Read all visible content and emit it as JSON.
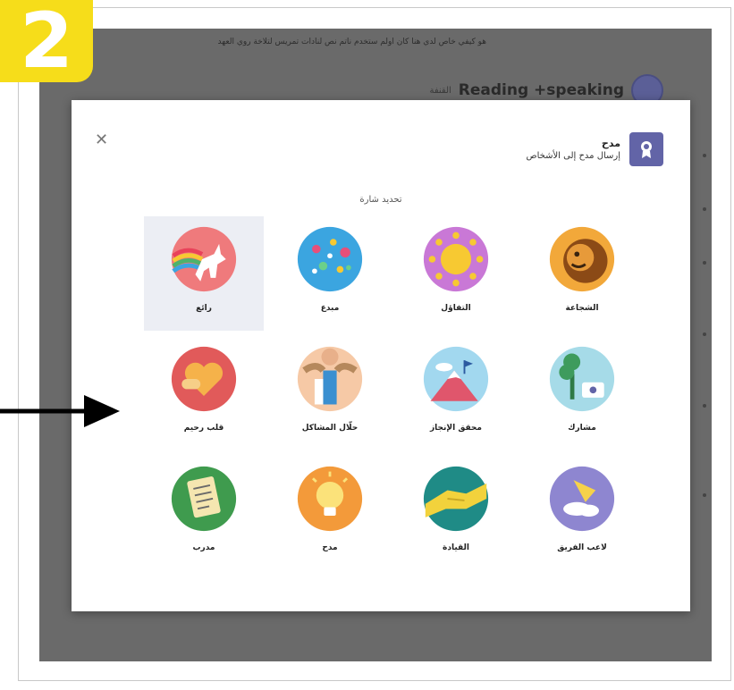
{
  "step_badge": {
    "number": "2"
  },
  "background": {
    "notice": "هو كيفي خاص لدي هنا كان اولم ستخدم ناتم نص لنادات تمريس لتلاخة روي العهد",
    "team_title": "Reading +speaking",
    "team_subtitle": "القنفة"
  },
  "modal": {
    "close_icon": "close-icon",
    "app_name": "مدح",
    "app_description": "إرسال مدح إلى الأشخاص",
    "section_label": "تحديد شارة",
    "badges": [
      {
        "label": "الشجاعة",
        "icon": "lion-icon",
        "colors": [
          "#f2a83a",
          "#8b4a16"
        ]
      },
      {
        "label": "التفاؤل",
        "icon": "sun-icon",
        "colors": [
          "#c978d6",
          "#f7c932"
        ]
      },
      {
        "label": "مبدع",
        "icon": "bubbles-icon",
        "colors": [
          "#3ba5e0",
          "#e64f7a"
        ]
      },
      {
        "label": "رائع",
        "icon": "unicorn-icon",
        "colors": [
          "#ef7a7c",
          "#ffffff"
        ],
        "selected": true
      },
      {
        "label": "مشارك",
        "icon": "tree-icon",
        "colors": [
          "#a6dbe8",
          "#3e9b5d"
        ]
      },
      {
        "label": "محقق الإنجاز",
        "icon": "mountain-icon",
        "colors": [
          "#a2d8ef",
          "#e0566c"
        ]
      },
      {
        "label": "حلّال المشاكل",
        "icon": "problem-solver-icon",
        "colors": [
          "#f6c9a6",
          "#3a8fd0"
        ]
      },
      {
        "label": "قلب رحيم",
        "icon": "heart-icon",
        "colors": [
          "#e15a5a",
          "#f5b24a"
        ]
      },
      {
        "label": "لاعب الفريق",
        "icon": "team-player-icon",
        "colors": [
          "#8e86d0",
          "#f6d24a"
        ]
      },
      {
        "label": "القيادة",
        "icon": "handshake-icon",
        "colors": [
          "#1f8b86",
          "#f2d23c"
        ]
      },
      {
        "label": "مدح",
        "icon": "lightbulb-icon",
        "colors": [
          "#f39a3a",
          "#fbe27a"
        ]
      },
      {
        "label": "مدرب",
        "icon": "checklist-icon",
        "colors": [
          "#3f9b4e",
          "#f5e6b0"
        ]
      }
    ]
  }
}
